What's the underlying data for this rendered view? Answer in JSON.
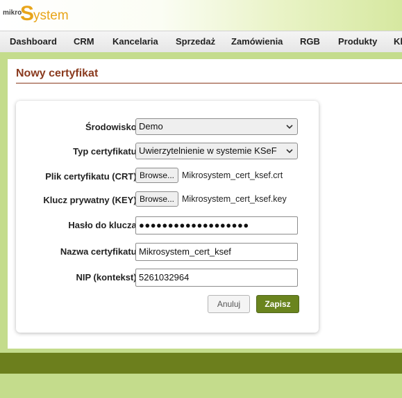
{
  "brand": {
    "mikro": "mikro",
    "s": "S",
    "rest": "ystem"
  },
  "nav": [
    "Dashboard",
    "CRM",
    "Kancelaria",
    "Sprzedaż",
    "Zamówienia",
    "RGB",
    "Produkty",
    "Kl"
  ],
  "page": {
    "title": "Nowy certyfikat"
  },
  "form": {
    "environment": {
      "label": "Środowisko:",
      "value": "Demo"
    },
    "cert_type": {
      "label": "Typ certyfikatu:",
      "value": "Uwierzytelnienie w systemie KSeF"
    },
    "cert_file": {
      "label": "Plik certyfikatu (CRT):",
      "button": "Browse...",
      "filename": "Mikrosystem_cert_ksef.crt"
    },
    "key_file": {
      "label": "Klucz prywatny (KEY):",
      "button": "Browse...",
      "filename": "Mikrosystem_cert_ksef.key"
    },
    "password": {
      "label": "Hasło do klucza:",
      "value": "●●●●●●●●●●●●●●●●●●●"
    },
    "cert_name": {
      "label": "Nazwa certyfikatu:",
      "value": "Mikrosystem_cert_ksef"
    },
    "nip": {
      "label": "NIP (kontekst):",
      "value": "5261032964"
    },
    "cancel": "Anuluj",
    "save": "Zapisz"
  },
  "colors": {
    "accent": "#6a841e",
    "title": "#8a3a1e",
    "footer": "#6c7f1d",
    "background": "#c4dc8c"
  }
}
